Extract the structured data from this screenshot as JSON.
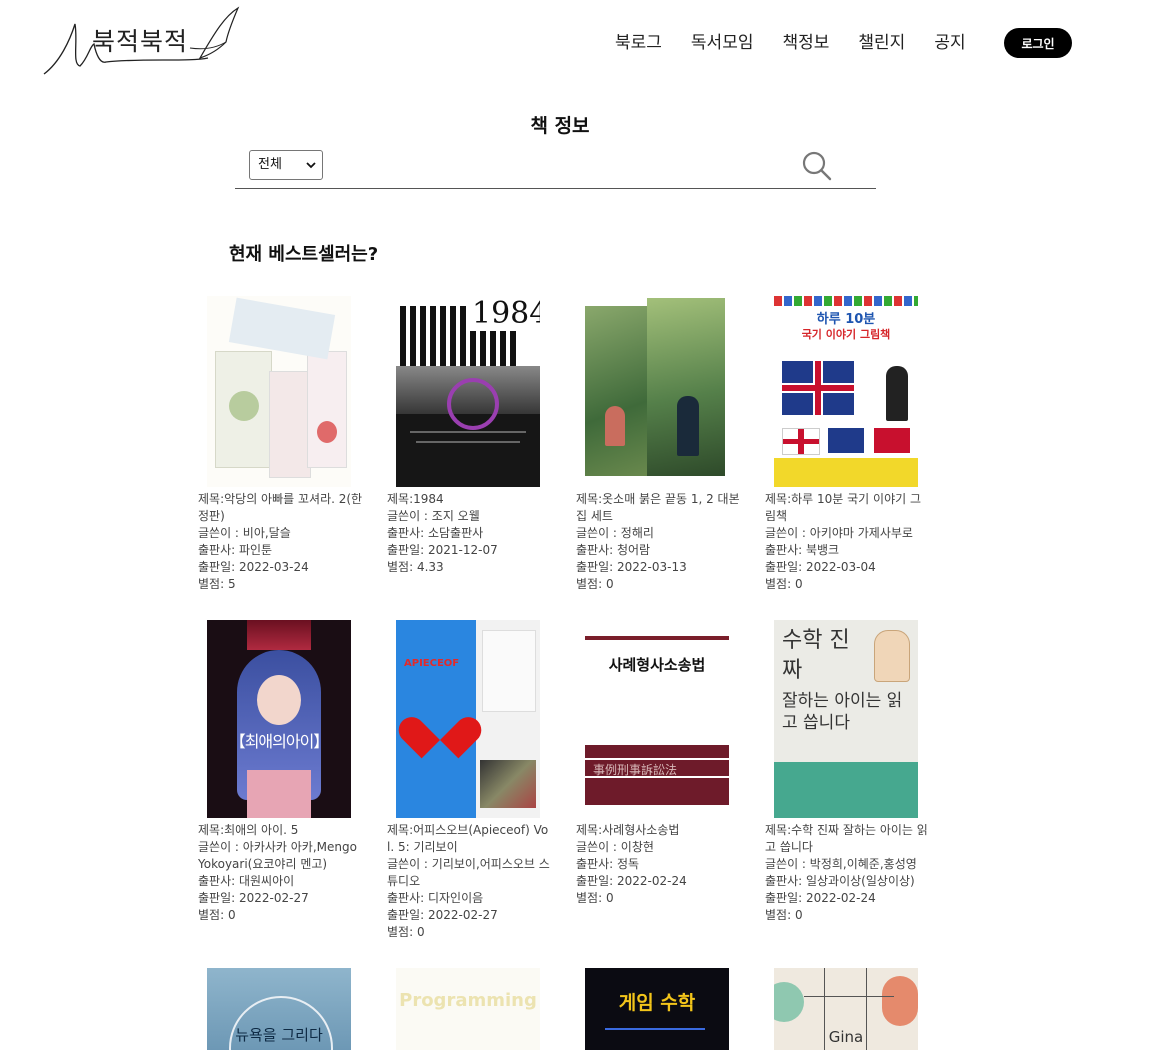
{
  "header": {
    "logo_text": "북적북적",
    "nav": [
      "북로그",
      "독서모임",
      "책정보",
      "챌린지",
      "공지"
    ],
    "login_label": "로그인"
  },
  "page_title": "책 정보",
  "search": {
    "filter_selected": "전체",
    "placeholder": ""
  },
  "section_title": "현재 베스트셀러는?",
  "books": [
    {
      "title": "제목:악당의 아빠를 꼬셔라. 2(한정판)",
      "author": "글쓴이 : 비아,달슬",
      "publisher": "출판사: 파인툰",
      "date": "출판일: 2022-03-24",
      "rating": "별점: 5"
    },
    {
      "title": "제목:1984",
      "author": "글쓴이 : 조지 오웰",
      "publisher": "출판사: 소담출판사",
      "date": "출판일: 2021-12-07",
      "rating": "별점: 4.33",
      "cover_text": "1984"
    },
    {
      "title": "제목:옷소매 붉은 끝동 1, 2 대본집 세트",
      "author": "글쓴이 : 정해리",
      "publisher": "출판사: 청어람",
      "date": "출판일: 2022-03-13",
      "rating": "별점: 0"
    },
    {
      "title": "제목:하루 10분 국기 이야기 그림책",
      "author": "글쓴이 : 아키야마 가제사부로",
      "publisher": "출판사: 북뱅크",
      "date": "출판일: 2022-03-04",
      "rating": "별점: 0",
      "cover_text": "하루 10분",
      "cover_text2": "국기 이야기 그림책"
    },
    {
      "title": "제목:최애의 아이. 5",
      "author": "글쓴이 : 아카사카 아카,Mengo Yokoyari(요코야리 멘고)",
      "publisher": "출판사: 대원씨아이",
      "date": "출판일: 2022-02-27",
      "rating": "별점: 0",
      "cover_text": "【최애의아이】"
    },
    {
      "title": "제목:어피스오브(Apieceof) Vol. 5: 기리보이",
      "author": "글쓴이 : 기리보이,어피스오브 스튜디오",
      "publisher": "출판사: 디자인이음",
      "date": "출판일: 2022-02-27",
      "rating": "별점: 0",
      "cover_text": "APIECEOF"
    },
    {
      "title": "제목:사례형사소송법",
      "author": "글쓴이 : 이창현",
      "publisher": "출판사: 정독",
      "date": "출판일: 2022-02-24",
      "rating": "별점: 0",
      "cover_text": "사례형사소송법",
      "cover_text2": "事例刑事訴訟法"
    },
    {
      "title": "제목:수학 진짜 잘하는 아이는 읽고 씁니다",
      "author": "글쓴이 : 박정희,이혜준,홍성영",
      "publisher": "출판사: 일상과이상(일상이상)",
      "date": "출판일: 2022-02-24",
      "rating": "별점: 0",
      "cover_text": "수학 진짜",
      "cover_text2": "잘하는 아이는 읽고 씁니다"
    },
    {
      "cover_text": "뉴욕을 그리다"
    },
    {
      "cover_text": "Programming"
    },
    {
      "cover_text": "게임 수학"
    },
    {
      "cover_text": "Gina"
    }
  ]
}
